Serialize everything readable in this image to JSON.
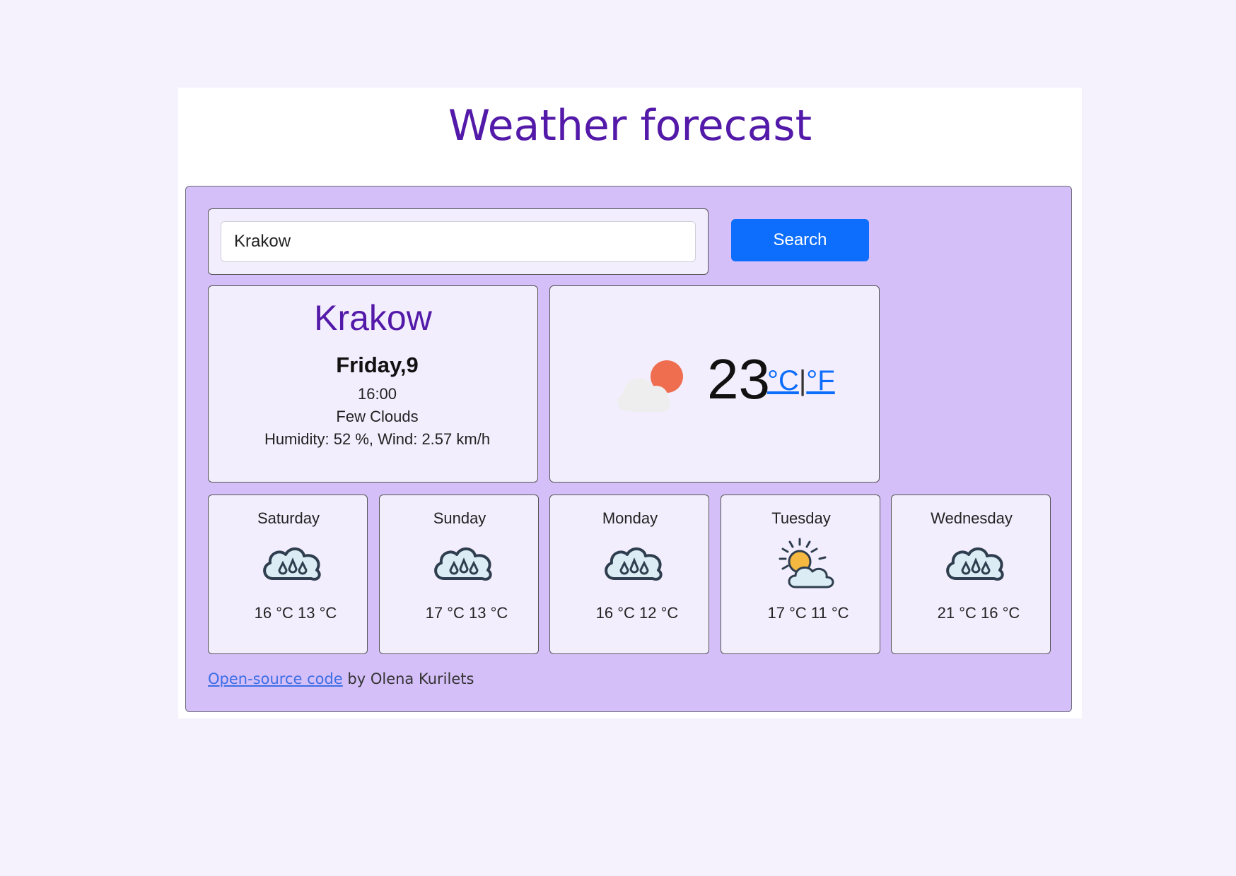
{
  "header": {
    "title": "Weather forecast"
  },
  "search": {
    "value": "Krakow",
    "button_label": "Search"
  },
  "current": {
    "city": "Krakow",
    "date": "Friday,9",
    "time": "16:00",
    "description": "Few Clouds",
    "details": "Humidity: 52 %, Wind: 2.57 km/h",
    "temperature": "23",
    "unit_celsius": "°C",
    "unit_separator": "|",
    "unit_fahrenheit": "°F",
    "icon": "few-clouds-icon"
  },
  "forecast": [
    {
      "day": "Saturday",
      "temps": "16 °C 13 °C",
      "icon": "rain-cloud-icon"
    },
    {
      "day": "Sunday",
      "temps": "17 °C 13 °C",
      "icon": "rain-cloud-icon"
    },
    {
      "day": "Monday",
      "temps": "16 °C 12 °C",
      "icon": "rain-cloud-icon"
    },
    {
      "day": "Tuesday",
      "temps": "17 °C 11 °C",
      "icon": "sun-behind-cloud-icon"
    },
    {
      "day": "Wednesday",
      "temps": "21 °C 16 °C",
      "icon": "rain-cloud-icon"
    }
  ],
  "footer": {
    "link_text": "Open-source code",
    "suffix": " by Olena Kurilets"
  },
  "colors": {
    "page_background": "#f5f1fd",
    "panel_background": "#d5bff8",
    "card_background": "#f3eefd",
    "title_color": "#5319a8",
    "button_color": "#0d6efd"
  }
}
